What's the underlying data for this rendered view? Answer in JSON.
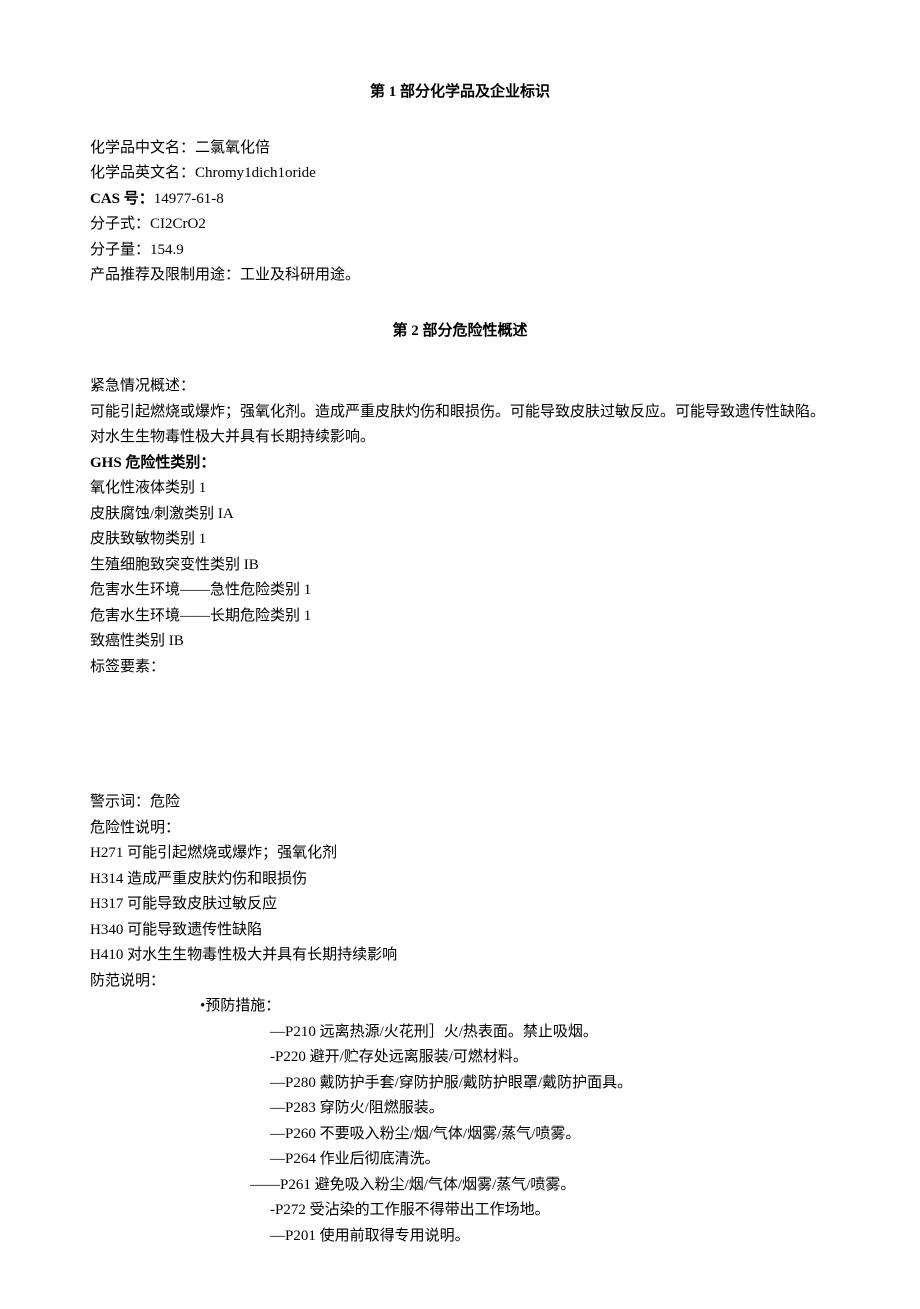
{
  "section1": {
    "title": "第 1 部分化学品及企业标识",
    "fields": {
      "name_cn_label": "化学品中文名：",
      "name_cn_value": "二氯氧化倍",
      "name_en_label": "化学品英文名：",
      "name_en_value": "Chromy1dich1oride",
      "cas_label": "CAS 号：",
      "cas_value": "14977-61-8",
      "formula_label": "分子式：",
      "formula_value": "CI2CrO2",
      "mw_label": "分子量：",
      "mw_value": "154.9",
      "use_label": "产品推荐及限制用途：",
      "use_value": "工业及科研用途。"
    }
  },
  "section2": {
    "title": "第 2 部分危险性概述",
    "emergency_label": "紧急情况概述：",
    "emergency_text": "可能引起燃烧或爆炸；强氧化剂。造成严重皮肤灼伤和眼损伤。可能导致皮肤过敏反应。可能导致遗传性缺陷。对水生生物毒性极大并具有长期持续影响。",
    "ghs_label": "GHS 危险性类别：",
    "ghs_items": [
      "氧化性液体类别 1",
      "皮肤腐蚀/刺激类别 IA",
      "皮肤致敏物类别 1",
      "生殖细胞致突变性类别 IB",
      "危害水生环境——急性危险类别 1",
      "危害水生环境——长期危险类别 1",
      "致癌性类别 IB"
    ],
    "label_elements": "标签要素：",
    "signal_label": "警示词：",
    "signal_value": "危险",
    "hazard_label": "危险性说明：",
    "hazard_items": [
      "H271 可能引起燃烧或爆炸；强氧化剂",
      "H314 造成严重皮肤灼伤和眼损伤",
      "H317 可能导致皮肤过敏反应",
      "H340 可能导致遗传性缺陷",
      "H410 对水生生物毒性极大并具有长期持续影响"
    ],
    "precaution_label": "防范说明：",
    "prevention_label": "•预防措施：",
    "prevention_items": [
      "—P210 远离热源/火花刑］火/热表面。禁止吸烟。",
      "-P220 避开/贮存处远离服装/可燃材料。",
      "—P280 戴防护手套/穿防护服/戴防护眼罩/戴防护面具。",
      "—P283 穿防火/阻燃服装。",
      "—P260 不要吸入粉尘/烟/气体/烟雾/蒸气/喷雾。",
      "—P264 作业后彻底清洗。",
      "——P261 避免吸入粉尘/烟/气体/烟雾/蒸气/喷雾。",
      "-P272 受沾染的工作服不得带出工作场地。",
      "—P201 使用前取得专用说明。"
    ]
  }
}
